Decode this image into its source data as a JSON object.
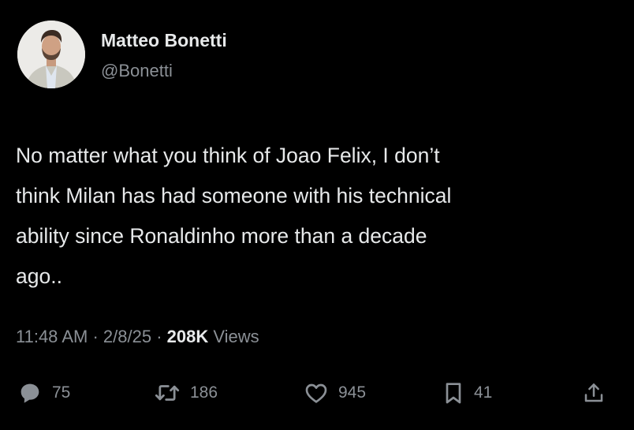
{
  "author": {
    "name": "Matteo Bonetti",
    "handle": "@Bonetti"
  },
  "tweet": {
    "text_lines": [
      "No matter what you think of Joao Felix, I don’t",
      "think Milan has had someone with his technical",
      "ability since Ronaldinho more than a decade",
      "ago.."
    ],
    "time": "11:48 AM",
    "date": "2/8/25",
    "separator": "·",
    "views_count": "208K",
    "views_label": "Views"
  },
  "actions": {
    "replies": "75",
    "retweets": "186",
    "likes": "945",
    "bookmarks": "41"
  },
  "icons": {
    "reply": "reply-icon",
    "retweet": "retweet-icon",
    "like": "heart-icon",
    "bookmark": "bookmark-icon",
    "share": "share-icon"
  },
  "colors": {
    "background": "#000000",
    "primary_text": "#e7e9ea",
    "secondary_text": "#8b9096"
  }
}
